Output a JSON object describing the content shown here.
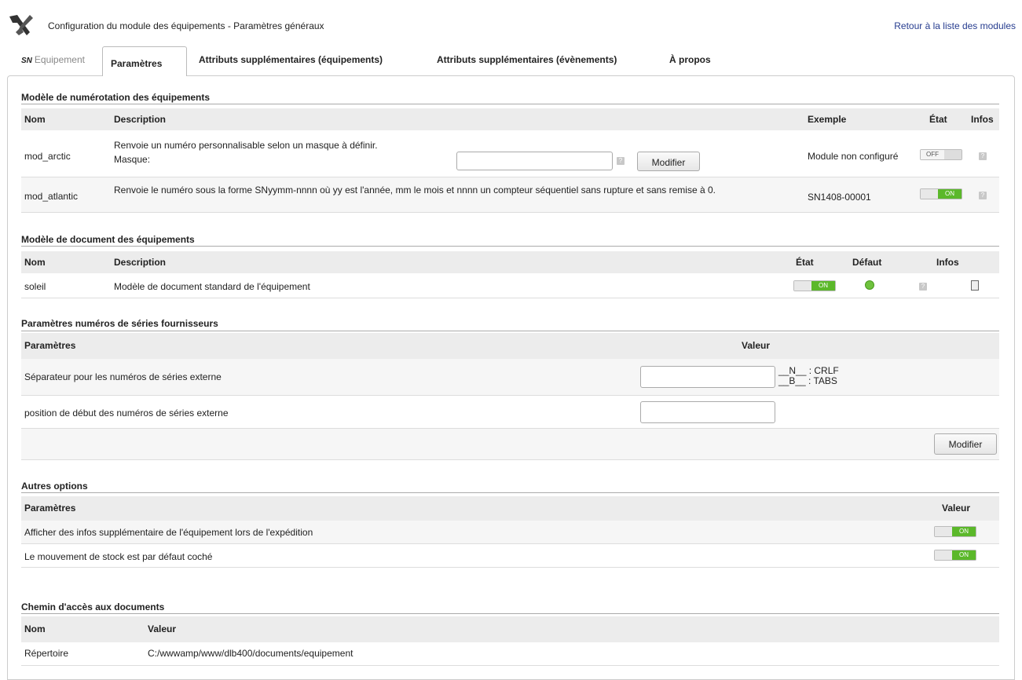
{
  "header": {
    "title": "Configuration du module des équipements - Paramètres généraux",
    "back_link": "Retour à la liste des modules"
  },
  "tabs": [
    {
      "label": "Equipement"
    },
    {
      "label": "Paramètres"
    },
    {
      "label": "Attributs supplémentaires (équipements)"
    },
    {
      "label": "Attributs supplémentaires (évènements)"
    },
    {
      "label": "À propos"
    }
  ],
  "tab_logo": "SN",
  "numbering": {
    "title": "Modèle de numérotation des équipements",
    "headers": {
      "name": "Nom",
      "description": "Description",
      "example": "Exemple",
      "state": "État",
      "infos": "Infos"
    },
    "rows": [
      {
        "name": "mod_arctic",
        "description": "Renvoie un numéro personnalisable selon un masque à définir.",
        "mask_label": "Masque:",
        "button": "Modifier",
        "example": "Module non configuré",
        "state": "OFF"
      },
      {
        "name": "mod_atlantic",
        "description": "Renvoie le numéro sous la forme SNyymm-nnnn où yy est l'année, mm le mois et nnnn un compteur séquentiel sans rupture et sans remise à 0.",
        "example": "SN1408-00001",
        "state": "ON"
      }
    ]
  },
  "documents": {
    "title": "Modèle de document des équipements",
    "headers": {
      "name": "Nom",
      "description": "Description",
      "state": "État",
      "default": "Défaut",
      "infos": "Infos"
    },
    "rows": [
      {
        "name": "soleil",
        "description": "Modèle de document standard de l'équipement",
        "state": "ON"
      }
    ]
  },
  "serials": {
    "title": "Paramètres numéros de séries fournisseurs",
    "headers": {
      "param": "Paramètres",
      "value": "Valeur"
    },
    "rows": [
      {
        "label": "Séparateur pour les numéros de séries externe",
        "legend_n": "__N__ : CRLF",
        "legend_b": "__B__ : TABS"
      },
      {
        "label": "position de début des numéros de séries externe"
      }
    ],
    "button": "Modifier"
  },
  "other": {
    "title": "Autres options",
    "headers": {
      "param": "Paramètres",
      "value": "Valeur"
    },
    "rows": [
      {
        "label": "Afficher des infos supplémentaire de l'équipement lors de l'expédition",
        "state": "ON"
      },
      {
        "label": "Le mouvement de stock est par défaut coché",
        "state": "ON"
      }
    ]
  },
  "paths": {
    "title": "Chemin d'accès aux documents",
    "headers": {
      "name": "Nom",
      "value": "Valeur"
    },
    "rows": [
      {
        "name": "Répertoire",
        "value": "C:/wwwamp/www/dlb400/documents/equipement"
      }
    ]
  },
  "colors": {
    "toggle_on": "#5bb82a",
    "link": "#263c8f",
    "header_bg": "#ececec"
  }
}
